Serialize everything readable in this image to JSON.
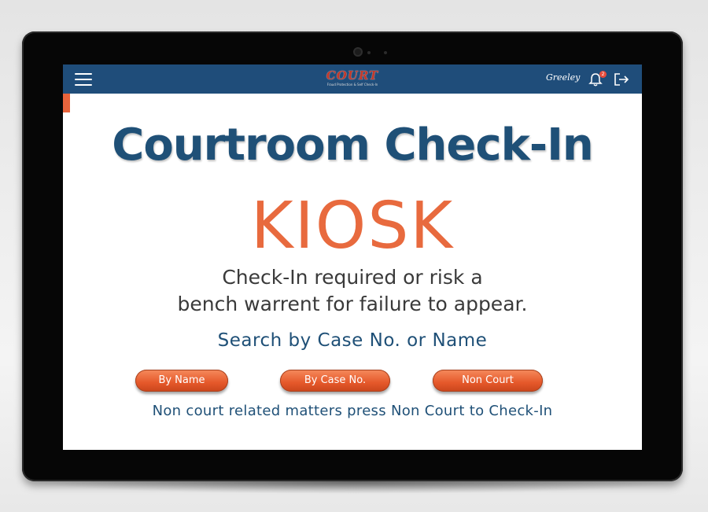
{
  "app": {
    "logo_text": "COURT",
    "logo_tagline": "Fraud Protection & Self Check-In",
    "city_logo": "Greeley"
  },
  "header": {
    "notification_count": "2"
  },
  "main": {
    "title": "Courtroom Check-In",
    "subtitle": "KIOSK",
    "warning_line1": "Check-In required or risk a",
    "warning_line2": "bench warrent for failure to appear.",
    "search_label": "Search by Case No. or Name",
    "buttons": {
      "by_name": "By Name",
      "by_case": "By Case No.",
      "non_court": "Non Court"
    },
    "note": "Non court related matters press Non Court to Check-In"
  },
  "colors": {
    "header_bg": "#1f4d7a",
    "title": "#1f5077",
    "accent": "#e86a3e"
  },
  "icons": [
    "menu-icon",
    "bell-icon",
    "logout-icon"
  ]
}
